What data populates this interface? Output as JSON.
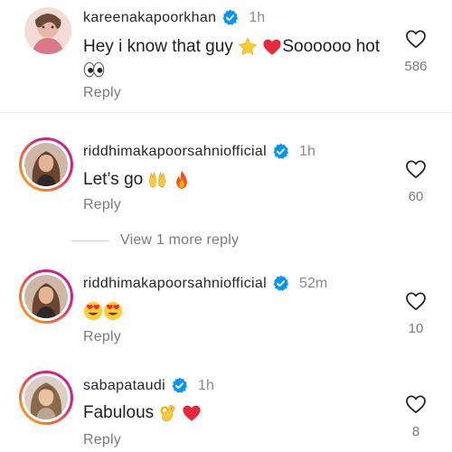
{
  "comments": [
    {
      "username": "kareenakapoorkhan",
      "time": "1h",
      "text": "Hey i know that guy",
      "text_after_emojis": "Soooooo hot",
      "emojis": [
        "star",
        "red-heart",
        "eyes"
      ],
      "like_count": "586",
      "reply_label": "Reply"
    },
    {
      "username": "riddhimakapoorsahniofficial",
      "time": "1h",
      "text": "Let’s go",
      "emojis": [
        "raising-hands",
        "fire"
      ],
      "like_count": "60",
      "reply_label": "Reply"
    },
    {
      "username": "riddhimakapoorsahniofficial",
      "time": "52m",
      "text": "",
      "emojis": [
        "heart-eyes",
        "heart-eyes"
      ],
      "like_count": "10",
      "reply_label": "Reply"
    },
    {
      "username": "sabapataudi",
      "time": "1h",
      "text": "Fabulous",
      "emojis": [
        "ok-hand",
        "red-heart"
      ],
      "like_count": "8",
      "reply_label": "Reply"
    }
  ],
  "view_more_replies": "View 1 more reply",
  "colors": {
    "verified_blue": "#0095f6",
    "muted_text": "#7b7b7b",
    "story_ring_start": "#f7b51a",
    "story_ring_end": "#b628a8"
  }
}
